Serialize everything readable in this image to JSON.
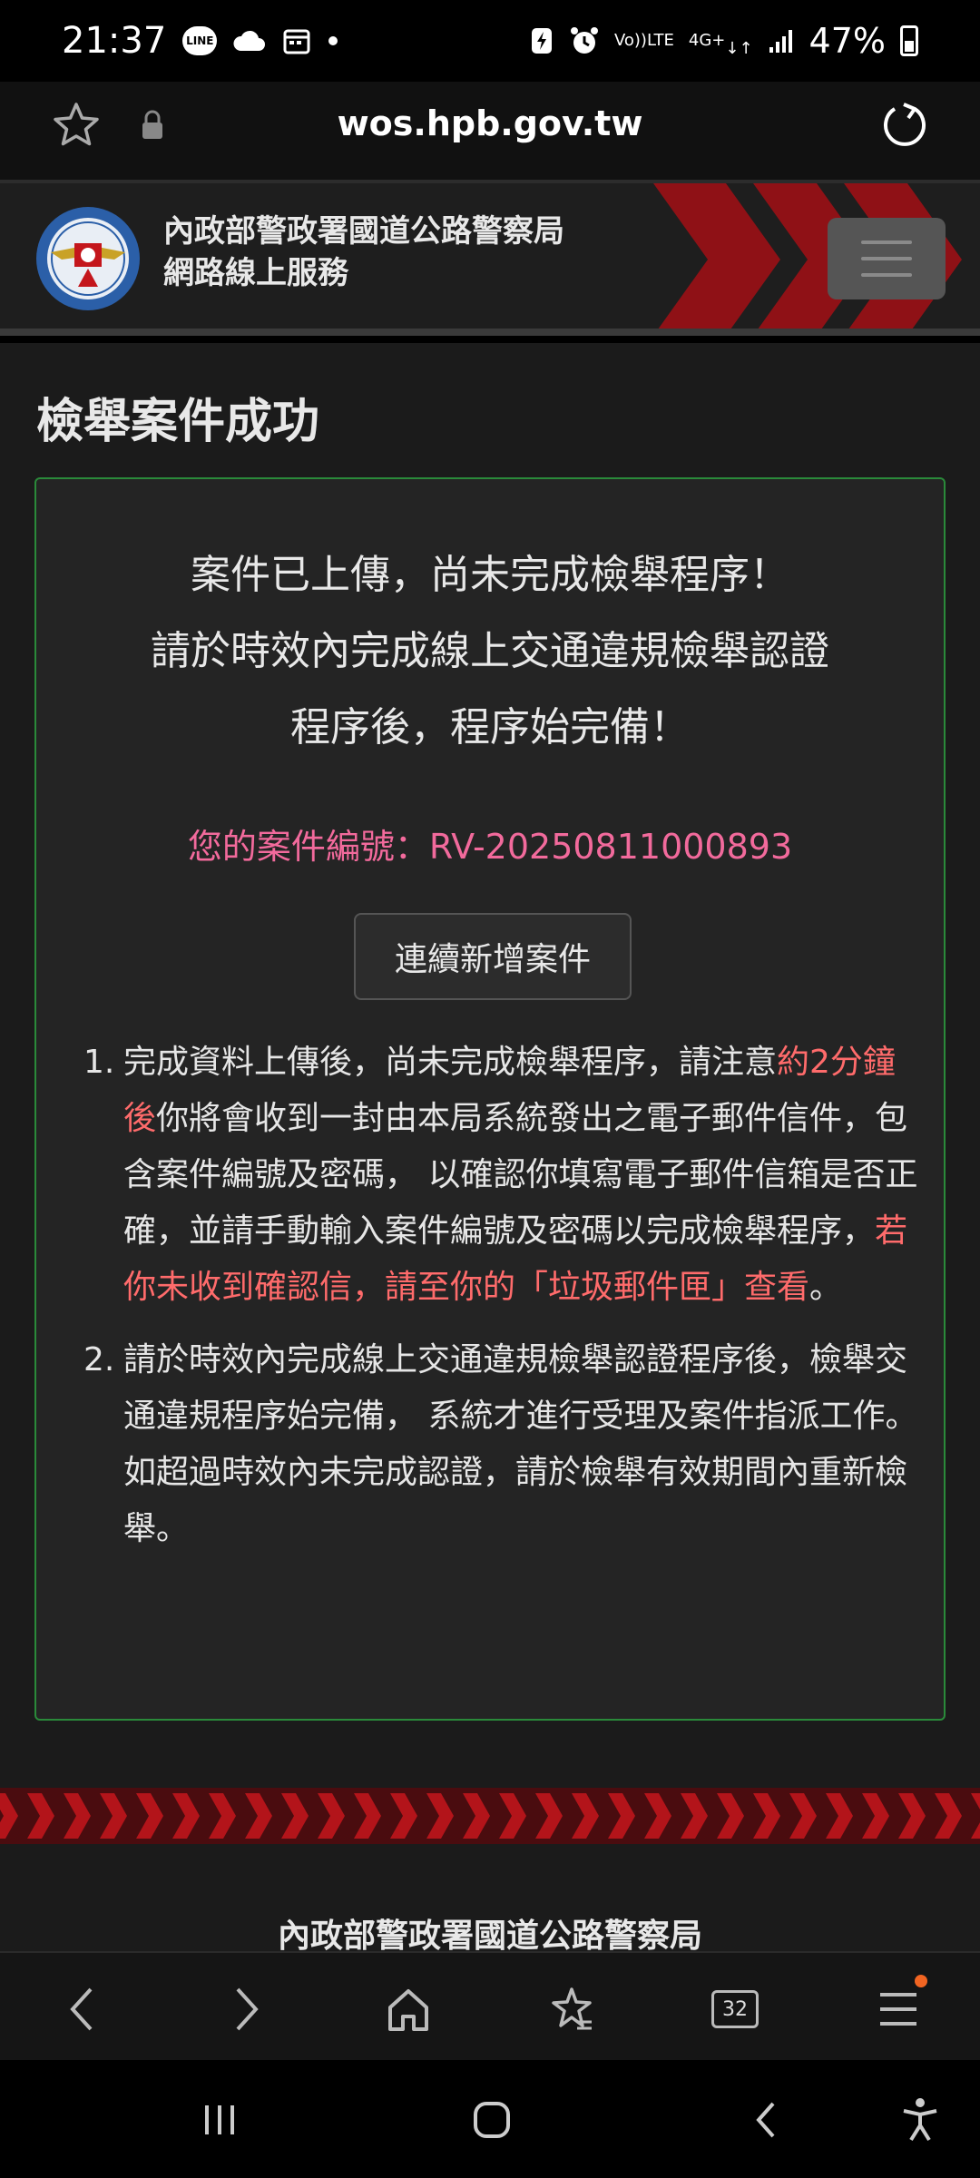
{
  "status_bar": {
    "time": "21:37",
    "line_badge": "LINE",
    "volte_top": "Vo))",
    "volte_bottom": "LTE",
    "net_top": "4G+",
    "battery": "47%"
  },
  "browser": {
    "url": "wos.hpb.gov.tw",
    "tabs_count": "32"
  },
  "site_header": {
    "title_line1": "內政部警政署國道公路警察局",
    "title_line2": "網路線上服務"
  },
  "page": {
    "title": "檢舉案件成功",
    "heading_line1": "案件已上傳，尚未完成檢舉程序！",
    "heading_line2": "請於時效內完成線上交通違規檢舉認證",
    "heading_line3": "程序後，程序始完備！",
    "case_number_label": "您的案件編號：",
    "case_number": "RV-20250811000893",
    "continue_button": "連續新增案件",
    "notes": [
      {
        "num": "1.",
        "part1": "完成資料上傳後，尚未完成檢舉程序，請注意",
        "hl1": "約2分鐘後",
        "part2": "你將會收到一封由本局系統發出之電子郵件信件，包含案件編號及密碼， 以確認你填寫電子郵件信箱是否正確，並請手動輸入案件編號及密碼以完成檢舉程序，",
        "hl2": "若你未收到確認信，請至你的「垃圾郵件匣」查看",
        "part3": "。"
      },
      {
        "num": "2.",
        "text": "請於時效內完成線上交通違規檢舉認證程序後，檢舉交通違規程序始完備， 系統才進行受理及案件指派工作。如超過時效內未完成認證，請於檢舉有效期間內重新檢舉。"
      }
    ]
  },
  "footer": {
    "org": "內政部警政署國道公路警察局"
  },
  "icons": {
    "bookmark": "star-icon",
    "secure": "lock-icon",
    "reload": "reload-icon",
    "menu": "hamburger-icon",
    "back": "back-arrow-icon",
    "forward": "forward-arrow-icon",
    "home": "home-icon",
    "bookmarks": "bookmarks-icon",
    "tabs": "tabs-icon",
    "browser_menu": "browser-menu-icon"
  },
  "colors": {
    "accent_red": "#c4161c",
    "case_number": "#f26a9c",
    "highlight": "#ff6b6b",
    "card_border": "#2a8a3a",
    "notification": "#f26522"
  }
}
